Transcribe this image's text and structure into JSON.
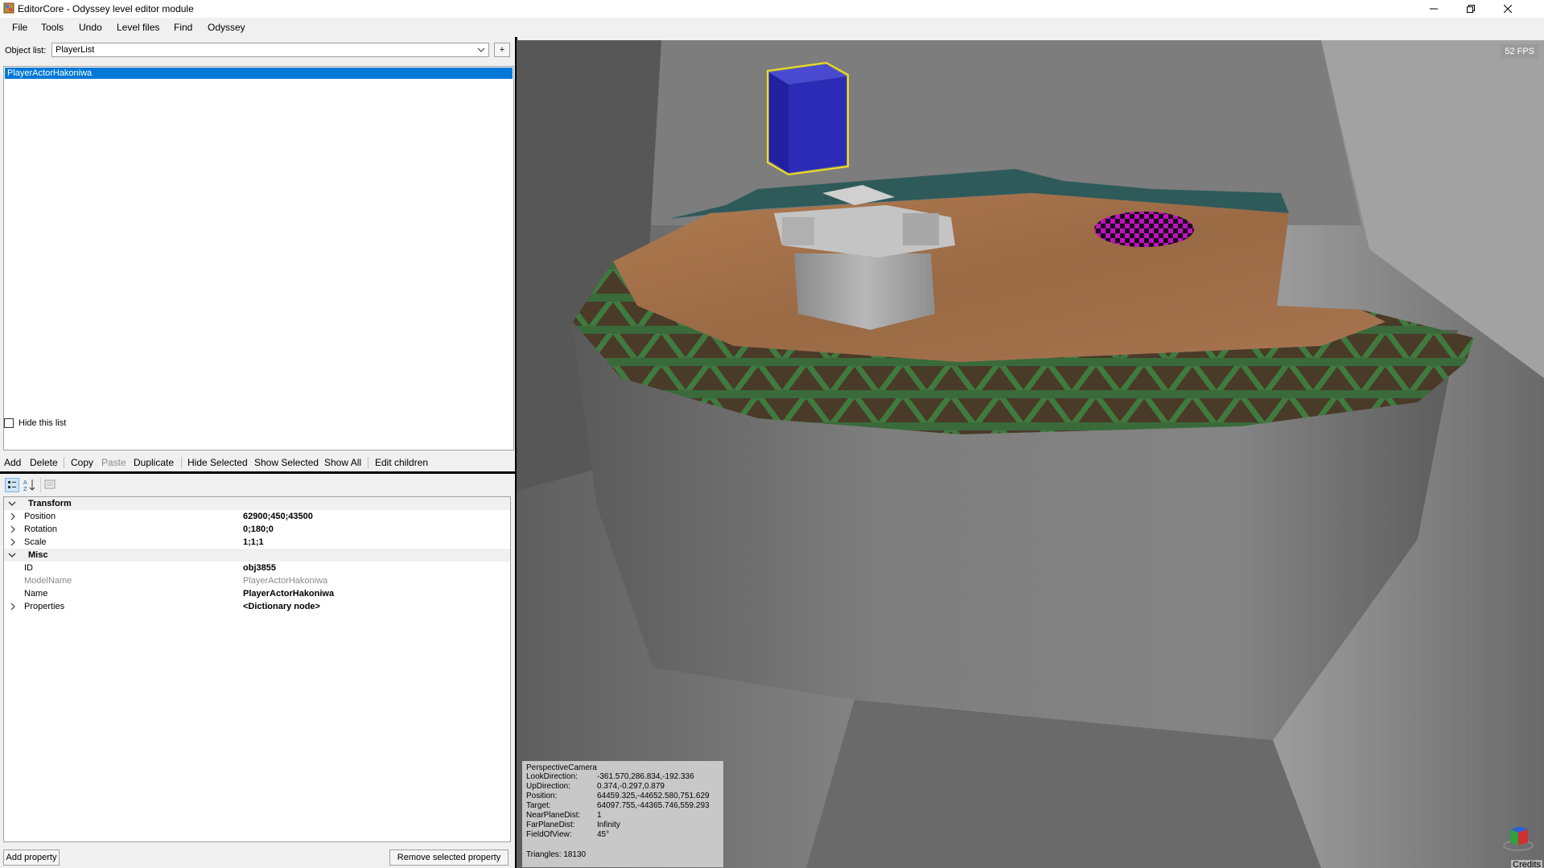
{
  "window": {
    "title": "EditorCore - Odyssey level editor module",
    "minimize_icon": "minimize-icon",
    "restore_icon": "restore-icon",
    "close_icon": "close-icon"
  },
  "menu": [
    "File",
    "Tools",
    "Undo",
    "Level files",
    "Find",
    "Odyssey"
  ],
  "object_list": {
    "label": "Object list:",
    "selected": "PlayerList",
    "add_label": "+",
    "items": [
      {
        "label": "PlayerActorHakoniwa",
        "selected": true
      }
    ],
    "hide_label": "Hide this list"
  },
  "toolbar": {
    "add": "Add",
    "delete": "Delete",
    "copy": "Copy",
    "paste": "Paste",
    "duplicate": "Duplicate",
    "hide_selected": "Hide Selected",
    "show_selected": "Show Selected",
    "show_all": "Show All",
    "edit_children": "Edit children"
  },
  "properties": {
    "transform": {
      "label": "Transform",
      "position": {
        "name": "Position",
        "value": "62900;450;43500"
      },
      "rotation": {
        "name": "Rotation",
        "value": "0;180;0"
      },
      "scale": {
        "name": "Scale",
        "value": "1;1;1"
      }
    },
    "misc": {
      "label": "Misc",
      "id": {
        "name": "ID",
        "value": "obj3855"
      },
      "model_name": {
        "name": "ModelName",
        "value": "PlayerActorHakoniwa"
      },
      "name": {
        "name": "Name",
        "value": "PlayerActorHakoniwa"
      },
      "props": {
        "name": "Properties",
        "value": "<Dictionary node>"
      }
    },
    "add_button": "Add property",
    "remove_button": "Remove selected property"
  },
  "viewport": {
    "fps": "52 FPS",
    "camera": {
      "title": "PerspectiveCamera",
      "look_direction": {
        "k": "LookDirection:",
        "v": "-361.570,286.834,-192.336"
      },
      "up_direction": {
        "k": "UpDirection:",
        "v": "0.374,-0.297,0.879"
      },
      "position": {
        "k": "Position:",
        "v": "64459.325,-44652.580,751.629"
      },
      "target": {
        "k": "Target:",
        "v": "64097.755,-44365.746,559.293"
      },
      "near": {
        "k": "NearPlaneDist:",
        "v": "1"
      },
      "far": {
        "k": "FarPlaneDist:",
        "v": "Infinity"
      },
      "fov": {
        "k": "FieldOfView:",
        "v": "45°"
      },
      "triangles": "Triangles: 18130"
    },
    "credits": "Credits",
    "colors": {
      "cube": "#2b2bb5",
      "selection": "#f0e020",
      "floor": "#a0704a",
      "rim": "#3a6a3a",
      "wall": "#7a7a7a",
      "checker": "#c010c0"
    }
  }
}
